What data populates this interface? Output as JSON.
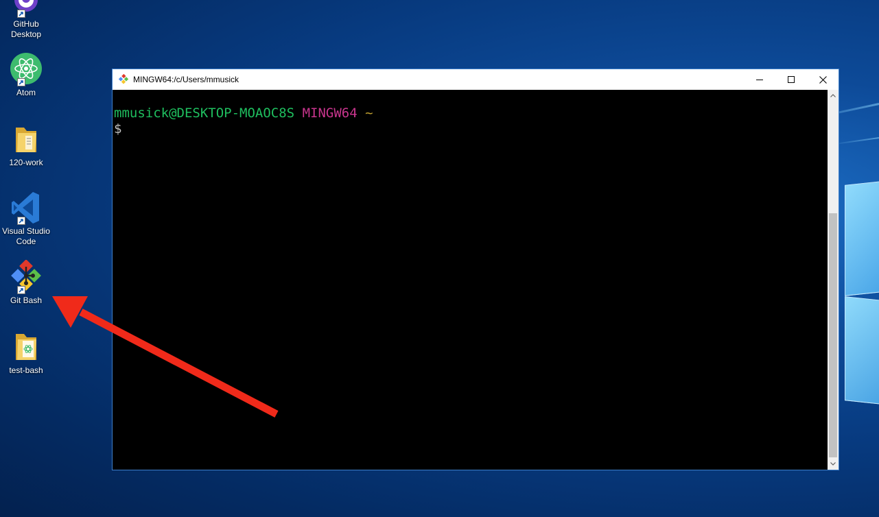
{
  "desktop": {
    "icons": [
      {
        "label": "GitHub Desktop",
        "icon": "github-desktop-icon"
      },
      {
        "label": "Atom",
        "icon": "atom-icon"
      },
      {
        "label": "120-work",
        "icon": "folder-icon"
      },
      {
        "label": "Visual Studio Code",
        "icon": "vscode-icon"
      },
      {
        "label": "Git Bash",
        "icon": "git-bash-icon"
      },
      {
        "label": "test-bash",
        "icon": "folder-icon"
      }
    ]
  },
  "window": {
    "title": "MINGW64:/c/Users/mmusick",
    "controls": {
      "minimize": "minimize-icon",
      "maximize": "maximize-icon",
      "close": "close-icon"
    }
  },
  "terminal": {
    "user_host": "mmusick@DESKTOP-MOAOC8S",
    "env": "MINGW64",
    "path": "~",
    "prompt": "$"
  },
  "colors": {
    "prompt_user": "#1fbf5f",
    "prompt_env": "#c8358d",
    "prompt_path": "#c0a030",
    "annotation_arrow": "#f02a1a",
    "window_border": "#3d7fcc"
  },
  "annotation": {
    "type": "arrow",
    "points_to": "Git Bash"
  }
}
